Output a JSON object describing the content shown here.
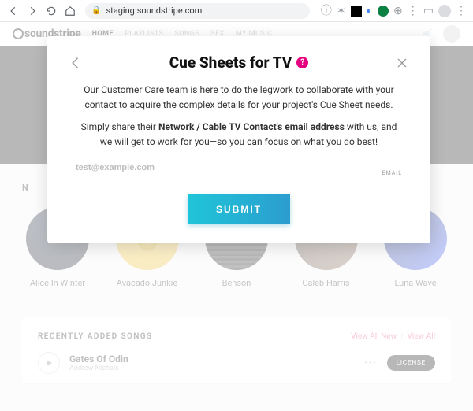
{
  "browser": {
    "url": "staging.soundstripe.com"
  },
  "site": {
    "logo": "soundstripe",
    "nav": [
      "HOME",
      "PLAYLISTS",
      "SONGS",
      "SFX",
      "MY MUSIC"
    ],
    "section_label": "N",
    "artists": [
      {
        "name": "Alice In Winter"
      },
      {
        "name": "Avacado Junkie"
      },
      {
        "name": "Benson"
      },
      {
        "name": "Caleb Harris"
      },
      {
        "name": "Luna Wave"
      }
    ],
    "songs_header": "RECENTLY ADDED SONGS",
    "songs_links": {
      "new": "View All New",
      "all": "View All"
    },
    "song": {
      "title": "Gates Of Odin",
      "artist": "Andrew Nichols"
    },
    "license_label": "LICENSE"
  },
  "modal": {
    "title": "Cue Sheets for TV",
    "para1": "Our Customer Care team is here to do the legwork to collaborate with your contact to acquire the complex details for your project's Cue Sheet needs.",
    "para2_pre": "Simply share their ",
    "para2_bold": "Network / Cable TV Contact's email address",
    "para2_post": " with us, and we will get to work for you—so you can focus on what you do best!",
    "placeholder": "test@example.com",
    "input_label": "EMAIL",
    "submit": "SUBMIT"
  }
}
